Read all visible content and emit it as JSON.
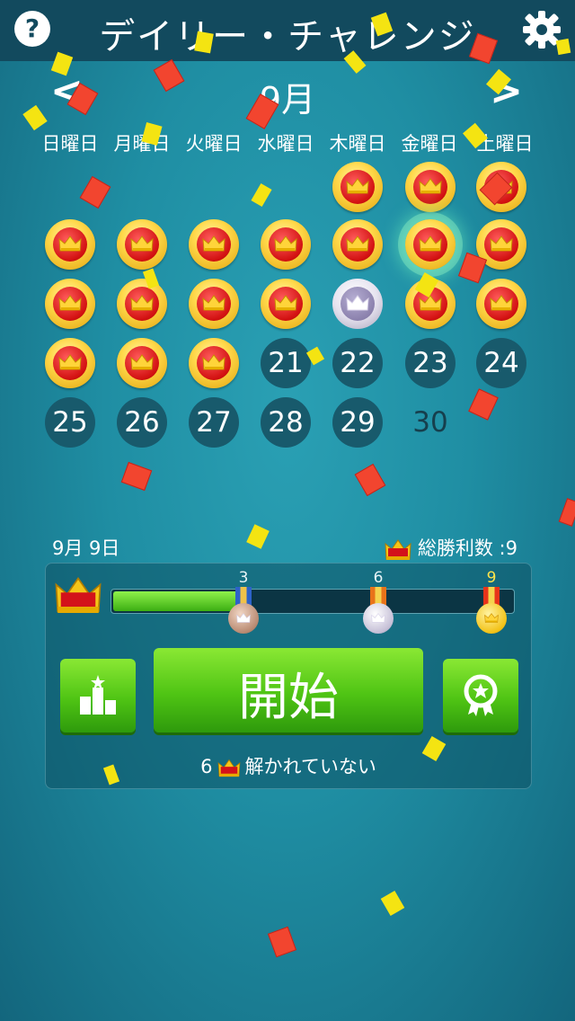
{
  "header": {
    "title": "デイリー・チャレンジ",
    "help_label": "?"
  },
  "nav": {
    "month": "9月",
    "prev": "<",
    "next": ">"
  },
  "weekdays": [
    "日曜日",
    "月曜日",
    "火曜日",
    "水曜日",
    "木曜日",
    "金曜日",
    "土曜日"
  ],
  "calendar": {
    "numbers": {
      "d21": "21",
      "d22": "22",
      "d23": "23",
      "d24": "24",
      "d25": "25",
      "d26": "26",
      "d27": "27",
      "d28": "28",
      "d29": "29",
      "d30": "30"
    }
  },
  "footer": {
    "date": "9月 9日",
    "total_wins_label": "総勝利数 :9",
    "progress": 0.32,
    "milestones": [
      "3",
      "6",
      "9"
    ],
    "start_label": "開始",
    "unsolved_count": "6",
    "unsolved_text": "解かれていない"
  },
  "colors": {
    "accent_green": "#4fc414",
    "coin_red": "#d21111",
    "coin_gold": "#ffd84a"
  }
}
